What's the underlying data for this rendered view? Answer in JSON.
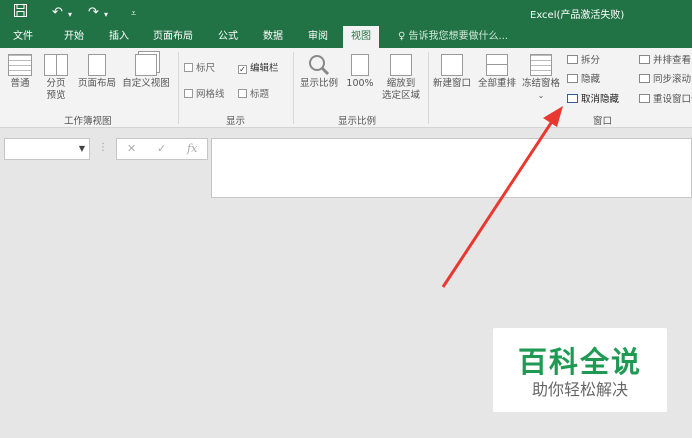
{
  "title_bar": {
    "window_title": "Excel(产品激活失败)",
    "save_icon": "save-icon",
    "undo_icon": "undo-icon",
    "redo_icon": "redo-icon",
    "qat_icon": "customize-qat-icon"
  },
  "tabs": [
    {
      "label": "文件"
    },
    {
      "label": "开始"
    },
    {
      "label": "插入"
    },
    {
      "label": "页面布局"
    },
    {
      "label": "公式"
    },
    {
      "label": "数据"
    },
    {
      "label": "审阅"
    },
    {
      "label": "视图",
      "active": true
    }
  ],
  "tell_me": "告诉我您想要做什么...",
  "ribbon": {
    "workbook_views": {
      "group_label": "工作簿视图",
      "normal": "普通",
      "page_break_l1": "分页",
      "page_break_l2": "预览",
      "page_layout": "页面布局",
      "custom_views": "自定义视图"
    },
    "show": {
      "group_label": "显示",
      "ruler": "标尺",
      "formula_bar": "编辑栏",
      "gridlines": "网格线",
      "headings": "标题",
      "formula_bar_checked": "✓"
    },
    "zoom": {
      "group_label": "显示比例",
      "zoom": "显示比例",
      "zoom_100": "100%",
      "zoom_sel_l1": "缩放到",
      "zoom_sel_l2": "选定区域"
    },
    "window": {
      "group_label": "窗口",
      "new_window": "新建窗口",
      "arrange_all": "全部重排",
      "freeze_panes": "冻结窗格",
      "split": "拆分",
      "hide": "隐藏",
      "unhide": "取消隐藏",
      "side_by_side": "并排查看",
      "sync_scroll": "同步滚动",
      "reset_position": "重设窗口位置"
    }
  },
  "formula_bar": {
    "name_box": "",
    "cancel": "✕",
    "enter": "✓",
    "fx": "fx",
    "content": ""
  },
  "watermark": {
    "title": "百科全说",
    "subtitle": "助你轻松解决"
  },
  "colors": {
    "excel_green": "#217346",
    "annotation_red": "#e8382f",
    "watermark_green": "#1f9a53"
  }
}
